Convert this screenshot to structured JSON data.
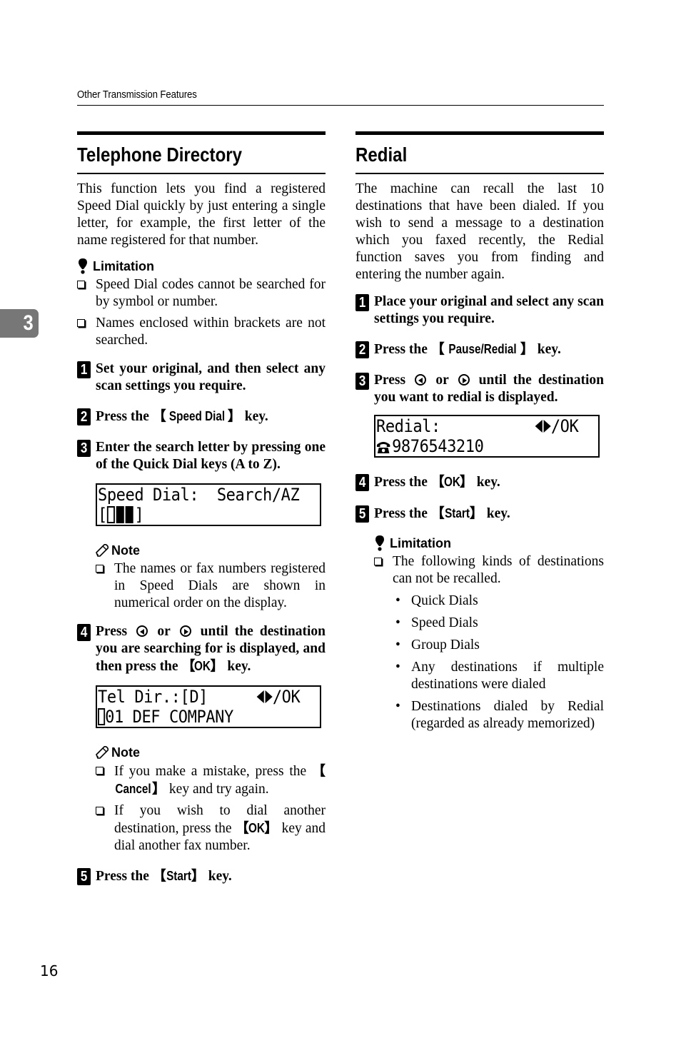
{
  "header": {
    "running_title": "Other Transmission Features"
  },
  "chapter_tab": {
    "number": "3",
    "color": "#777777"
  },
  "left_section": {
    "title": "Telephone Directory",
    "intro": "This function lets you find a registered Speed Dial quickly by just entering a single letter, for example, the first letter of the name registered for that number.",
    "limitation": {
      "heading": "Limitation",
      "items": [
        "Speed Dial codes cannot be searched for by symbol or number.",
        "Names enclosed within brackets are not searched."
      ]
    },
    "steps": [
      {
        "num": "1",
        "text": "Set your original, and then select any scan settings you require."
      },
      {
        "num": "2",
        "pre": "Press the ",
        "key": "Speed Dial",
        "post": " key."
      },
      {
        "num": "3",
        "text": "Enter the search letter by pressing one of the Quick Dial keys (A to Z)."
      },
      {
        "num": "4",
        "pre": "Press ",
        "mid1": " or ",
        "mid2": " until the destination you are searching for is displayed, and then press the ",
        "key": "OK",
        "post": " key."
      },
      {
        "num": "5",
        "pre": "Press the ",
        "key": "Start",
        "post": " key."
      }
    ],
    "lcd_search": {
      "line1": "Speed Dial:  Search/AZ",
      "line2_open": "[",
      "line2_close": "]"
    },
    "note1": {
      "heading": "Note",
      "items": [
        "The names or fax numbers registered in Speed Dials are shown in numerical order on the display."
      ]
    },
    "lcd_teldir": {
      "line1_left": "Tel Dir.:[D]",
      "line1_right": "/OK",
      "line2": "01 DEF COMPANY"
    },
    "note2": {
      "heading": "Note",
      "item1_pre": "If you make a mistake, press the ",
      "item1_key": "Cancel",
      "item1_post": " key and try again.",
      "item2_pre": "If you wish to dial another destination, press the ",
      "item2_key": "OK",
      "item2_post": " key and dial another fax number."
    }
  },
  "right_section": {
    "title": "Redial",
    "intro": "The machine can recall the last 10 destinations that have been dialed. If you wish to send a message to a destination which you faxed recently, the Redial function saves you from finding and entering the number again.",
    "steps": [
      {
        "num": "1",
        "text": "Place your original and select any scan settings you require."
      },
      {
        "num": "2",
        "pre": "Press the ",
        "key": "Pause/Redial",
        "post": " key."
      },
      {
        "num": "3",
        "pre": "Press ",
        "mid1": " or ",
        "mid2": " until the destination you want to redial is displayed."
      },
      {
        "num": "4",
        "pre": "Press the ",
        "key": "OK",
        "post": " key."
      },
      {
        "num": "5",
        "pre": "Press the ",
        "key": "Start",
        "post": " key."
      }
    ],
    "lcd_redial": {
      "line1_left": "Redial:",
      "line1_right": "/OK",
      "line2": "9876543210"
    },
    "limitation": {
      "heading": "Limitation",
      "item": "The following kinds of destinations can not be recalled.",
      "bullets": [
        "Quick Dials",
        "Speed Dials",
        "Group Dials",
        "Any destinations if multiple destinations were dialed",
        "Destinations dialed by Redial (regarded as already memorized)"
      ]
    }
  },
  "footer": {
    "page_number": "16"
  }
}
